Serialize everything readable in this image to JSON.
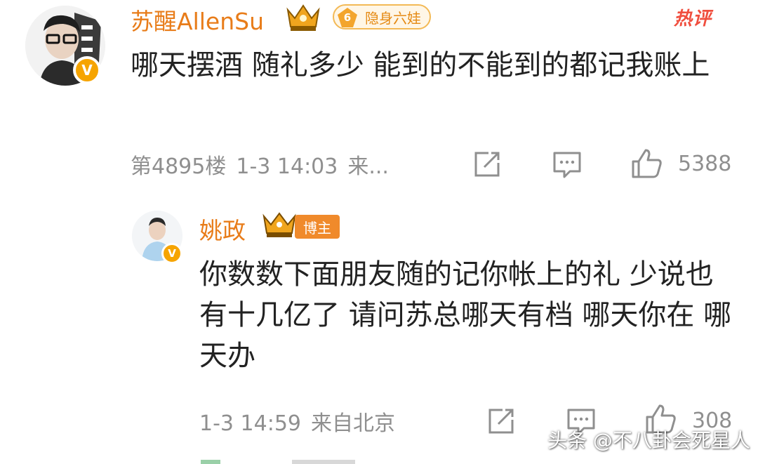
{
  "main_comment": {
    "author": "苏醒AllenSu",
    "level_number": "6",
    "level_label": "隐身六娃",
    "hot_label": "热评",
    "verified_badge": "V",
    "text": "哪天摆酒 随礼多少 能到的不能到的都记我账上",
    "floor": "第4895楼",
    "time": "1-3 14:03",
    "source": "来...",
    "like_count": "5388"
  },
  "reply": {
    "author": "姚政",
    "role_label": "博主",
    "verified_badge": "V",
    "text": "你数数下面朋友随的记你帐上的礼 少说也有十几亿了 请问苏总哪天有档 哪天你在 哪天办",
    "time": "1-3 14:59",
    "source": "来自北京",
    "like_count": "308"
  },
  "watermark": "头条 @不八卦会死星人",
  "colors": {
    "name": "#e87c19",
    "hot": "#f04e3e",
    "meta": "#8f8f8f",
    "badge": "#f6a400"
  },
  "icons": [
    "share-icon",
    "comment-icon",
    "like-icon",
    "crown-icon",
    "verified-icon"
  ]
}
